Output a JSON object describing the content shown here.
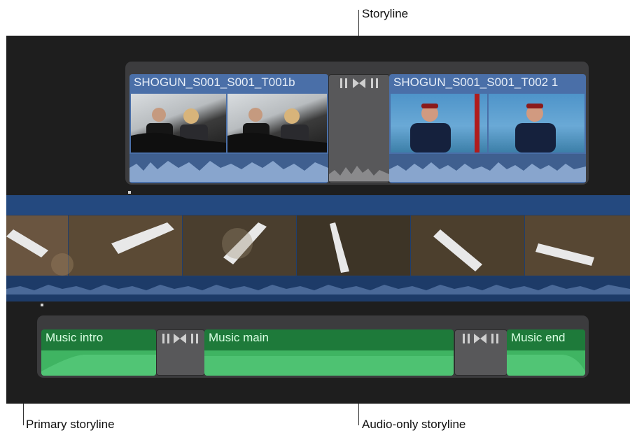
{
  "callouts": {
    "storyline": "Storyline",
    "primary_storyline": "Primary storyline",
    "audio_only_storyline": "Audio-only storyline"
  },
  "connected_storyline": {
    "clip1_name": "SHOGUN_S001_S001_T001b",
    "clip2_name": "SHOGUN_S001_S001_T002 1",
    "transition_icon": "cross-dissolve-icon"
  },
  "primary_storyline": {
    "clip_color": "#1f3e6e",
    "thumbnails": [
      "plane-aerial-1",
      "plane-aerial-2",
      "plane-aerial-3",
      "plane-aerial-4",
      "plane-aerial-5",
      "plane-aerial-6"
    ]
  },
  "audio_storyline": {
    "clips": [
      "Music intro",
      "Music main",
      "Music end"
    ],
    "color": "#2fa653"
  },
  "colors": {
    "video_clip_blue": "#4a6fa8",
    "audio_green": "#2fa653",
    "transition_gray": "#58585a",
    "timeline_bg": "#1e1e1e"
  }
}
